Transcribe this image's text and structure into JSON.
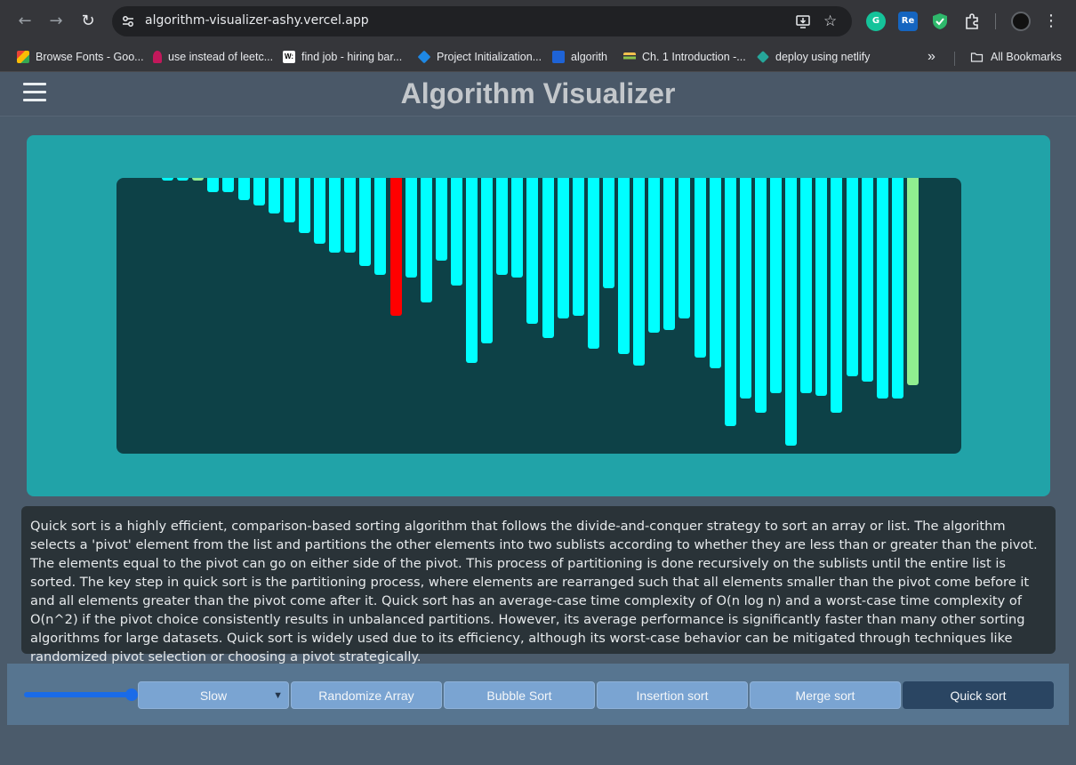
{
  "browser": {
    "url": "algorithm-visualizer-ashy.vercel.app",
    "bookmarks": [
      {
        "label": "Browse Fonts - Goo...",
        "color": "#ea4335"
      },
      {
        "label": "use instead of leetc...",
        "color": "#c2185b"
      },
      {
        "label": "find job - hiring bar...",
        "color": "#ffffff"
      },
      {
        "label": "Project Initialization...",
        "color": "#1e88e5"
      },
      {
        "label": "algorith",
        "color": "#1e63d6"
      },
      {
        "label": "Ch. 1 Introduction -...",
        "color": "#f2c14e"
      },
      {
        "label": "deploy using netlify",
        "color": "#26a69a"
      }
    ],
    "more_label": "»",
    "all_bookmarks_label": "All Bookmarks"
  },
  "app": {
    "title": "Algorithm Visualizer",
    "description": "Quick sort is a highly efficient, comparison-based sorting algorithm that follows the divide-and-conquer strategy to sort an array or list. The algorithm selects a 'pivot' element from the list and partitions the other elements into two sublists according to whether they are less than or greater than the pivot. The elements equal to the pivot can go on either side of the pivot. This process of partitioning is done recursively on the sublists until the entire list is sorted. The key step in quick sort is the partitioning process, where elements are rearranged such that all elements smaller than the pivot come before it and all elements greater than the pivot come after it. Quick sort has an average-case time complexity of O(n log n) and a worst-case time complexity of O(n^2) if the pivot choice consistently results in unbalanced partitions. However, its average performance is significantly faster than many other sorting algorithms for large datasets. Quick sort is widely used due to its efficiency, although its worst-case behavior can be mitigated through techniques like randomized pivot selection or choosing a pivot strategically.",
    "controls": {
      "speed_value": "Slow",
      "buttons": [
        "Randomize Array",
        "Bubble Sort",
        "Insertion sort",
        "Merge sort",
        "Quick sort"
      ],
      "active_button": "Quick sort",
      "slider_level": 1.0
    },
    "colors": {
      "bar_default": "#00ffff",
      "bar_compare": "#ff0000",
      "bar_pivot": "#90ee90",
      "panel": "#21a3a8",
      "canvas": "#0d4147"
    },
    "array": {
      "values": [
        1,
        1,
        1,
        5,
        5,
        8,
        10,
        13,
        16,
        20,
        24,
        27,
        27,
        32,
        35,
        50,
        36,
        45,
        30,
        39,
        67,
        60,
        35,
        36,
        53,
        58,
        51,
        50,
        62,
        40,
        64,
        68,
        56,
        55,
        51,
        65,
        69,
        90,
        80,
        85,
        78,
        97,
        78,
        79,
        85,
        72,
        74,
        80,
        80,
        75
      ],
      "max": 100,
      "states": [
        "default",
        "default",
        "pivot",
        "default",
        "default",
        "default",
        "default",
        "default",
        "default",
        "default",
        "default",
        "default",
        "default",
        "default",
        "default",
        "compare",
        "default",
        "default",
        "default",
        "default",
        "default",
        "default",
        "default",
        "default",
        "default",
        "default",
        "default",
        "default",
        "default",
        "default",
        "default",
        "default",
        "default",
        "default",
        "default",
        "default",
        "default",
        "default",
        "default",
        "default",
        "default",
        "default",
        "default",
        "default",
        "default",
        "default",
        "default",
        "default",
        "default",
        "pivot"
      ]
    }
  }
}
